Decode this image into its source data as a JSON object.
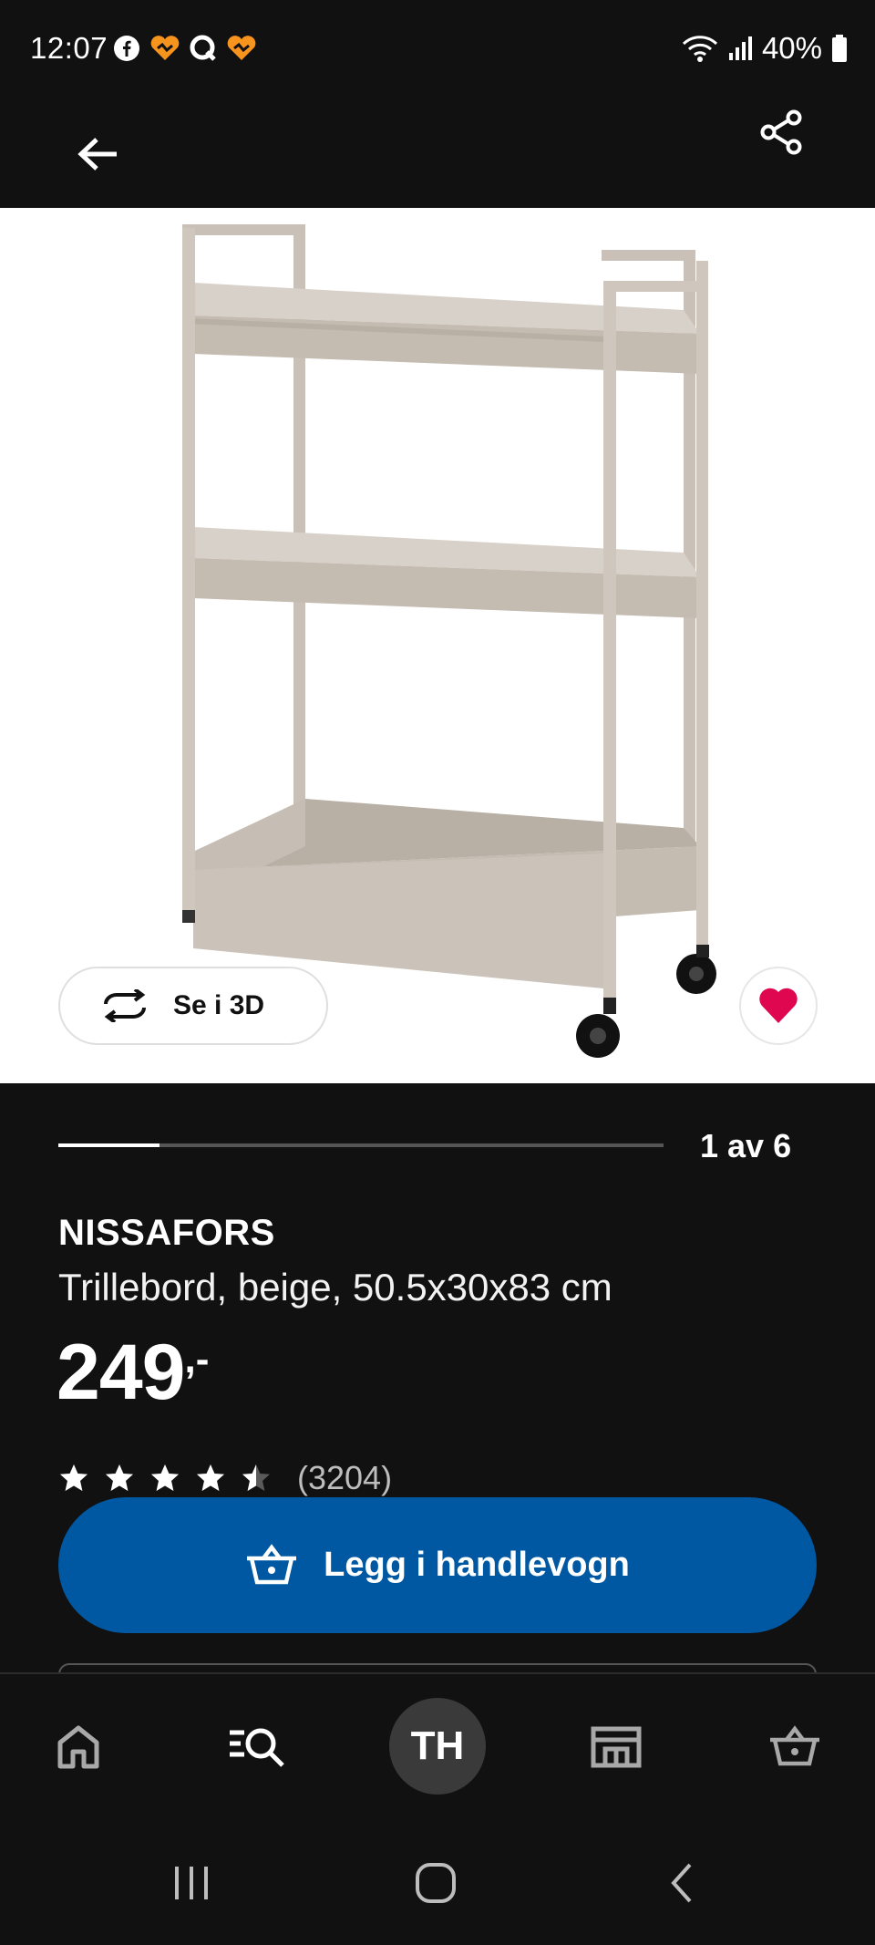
{
  "status_bar": {
    "time": "12:07",
    "battery": "40%",
    "app_icons": [
      "facebook-icon",
      "app-heart-icon",
      "app-q-icon",
      "app-heart-icon"
    ]
  },
  "header": {
    "back_icon": "arrow-left-icon",
    "share_icon": "share-icon"
  },
  "gallery": {
    "view3d_label": "Se i 3D",
    "pager_text": "1 av 6",
    "current": 1,
    "total": 6,
    "favorite_color": "#e00751"
  },
  "product": {
    "name": "NISSAFORS",
    "description": "Trillebord, beige, 50.5x30x83 cm",
    "price_int": "249",
    "price_dec": ",-",
    "rating": 4.5,
    "rating_max": 5,
    "rating_count": "(3204)"
  },
  "cta": {
    "add_to_cart_label": "Legg i handlevogn",
    "color": "#0058a3"
  },
  "bottom_nav": {
    "items": [
      "home-icon",
      "search-icon",
      "profile-avatar",
      "store-icon",
      "cart-icon"
    ],
    "avatar_initials": "TH"
  },
  "system_nav": [
    "recents-icon",
    "home-circle-icon",
    "back-chevron-icon"
  ]
}
